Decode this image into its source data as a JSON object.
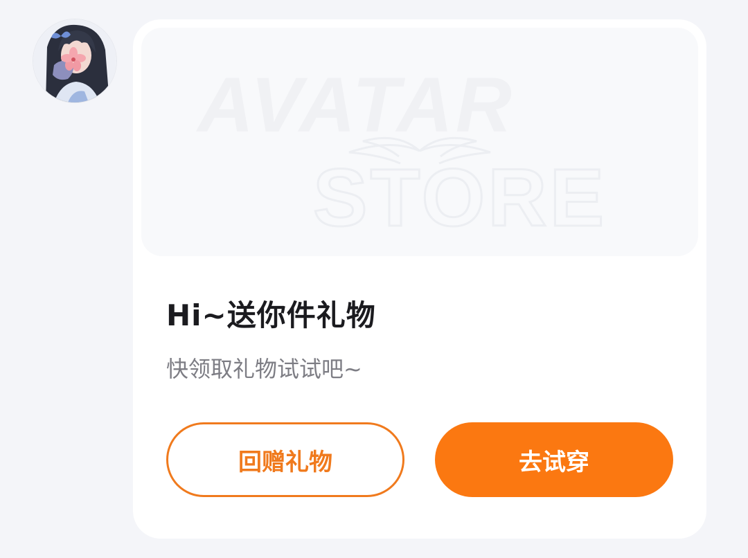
{
  "avatar": {
    "icon": "user-avatar-anime-girl"
  },
  "card": {
    "banner": {
      "logo_line1": "AVATAR",
      "logo_line2": "STORE"
    },
    "title": "Hi~送你件礼物",
    "subtitle": "快领取礼物试试吧~",
    "buttons": {
      "return_gift_label": "回赠礼物",
      "try_on_label": "去试穿"
    }
  },
  "colors": {
    "accent": "#fb7811",
    "accent_outline": "#f07a1d",
    "title_text": "#1b1b1f",
    "subtitle_text": "#7d7d84",
    "background": "#f4f5f9",
    "card_background": "#ffffff"
  }
}
